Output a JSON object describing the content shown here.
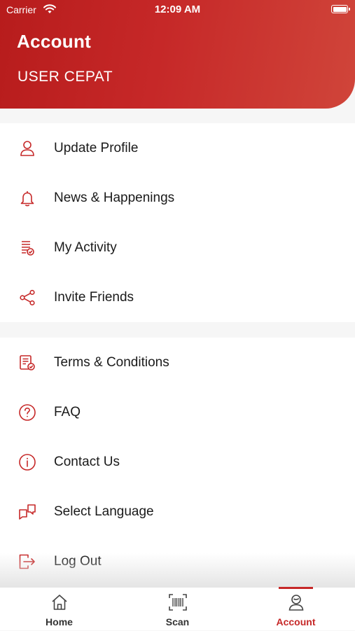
{
  "status_bar": {
    "carrier": "Carrier",
    "time": "12:09 AM"
  },
  "header": {
    "title": "Account",
    "user_name": "USER CEPAT"
  },
  "menu_group_1": [
    {
      "label": "Update Profile",
      "icon": "person-icon"
    },
    {
      "label": "News & Happenings",
      "icon": "bell-icon"
    },
    {
      "label": "My Activity",
      "icon": "activity-list-icon"
    },
    {
      "label": "Invite Friends",
      "icon": "share-icon"
    }
  ],
  "menu_group_2": [
    {
      "label": "Terms & Conditions",
      "icon": "document-check-icon"
    },
    {
      "label": "FAQ",
      "icon": "question-icon"
    },
    {
      "label": "Contact Us",
      "icon": "info-icon"
    },
    {
      "label": "Select Language",
      "icon": "language-icon"
    },
    {
      "label": "Log Out",
      "icon": "logout-icon"
    }
  ],
  "tabbar": {
    "tabs": [
      {
        "label": "Home",
        "icon": "home-icon"
      },
      {
        "label": "Scan",
        "icon": "barcode-scan-icon"
      },
      {
        "label": "Account",
        "icon": "account-icon"
      }
    ],
    "active_tab": "Account"
  },
  "colors": {
    "accent": "#c62828",
    "header_gradient_start": "#b71c1c",
    "header_gradient_end": "#d0453a"
  }
}
